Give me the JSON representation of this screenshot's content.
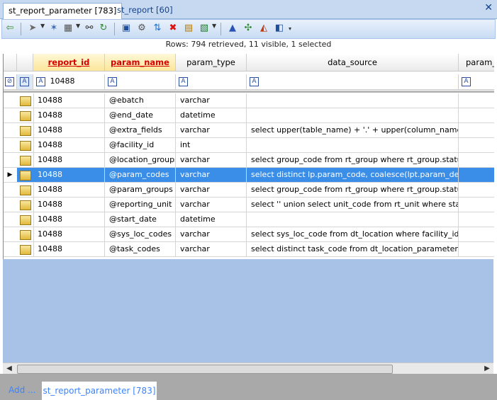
{
  "tabs": [
    {
      "label": "st_report_parameter [783]",
      "active": true
    },
    {
      "label": "st_report [60]",
      "active": false
    }
  ],
  "close_glyph": "✕",
  "toolbar": {
    "icons": [
      "back-arrow-icon",
      "run-icon",
      "pin-icon",
      "grid-icon",
      "binoculars-icon",
      "refresh-icon",
      "save-icon",
      "gear-icon",
      "sort-icon",
      "delete-icon",
      "export-icon",
      "excel-icon",
      "chart-icon",
      "tools-icon",
      "pdf-icon",
      "filter-icon",
      "more-icon"
    ]
  },
  "status": "Rows: 794 retrieved, 11 visible, 1 selected",
  "columns": [
    "report_id",
    "param_name",
    "param_type",
    "data_source",
    "param_"
  ],
  "filter": {
    "report_id": "10488"
  },
  "rows": [
    {
      "report_id": "10488",
      "param_name": "@ebatch",
      "param_type": "varchar",
      "data_source": ""
    },
    {
      "report_id": "10488",
      "param_name": "@end_date",
      "param_type": "datetime",
      "data_source": ""
    },
    {
      "report_id": "10488",
      "param_name": "@extra_fields",
      "param_type": "varchar",
      "data_source": "select upper(table_name) + '.' + upper(column_name)..."
    },
    {
      "report_id": "10488",
      "param_name": "@facility_id",
      "param_type": "int",
      "data_source": ""
    },
    {
      "report_id": "10488",
      "param_name": "@location_groups",
      "param_type": "varchar",
      "data_source": "select group_code from rt_group where rt_group.status..."
    },
    {
      "report_id": "10488",
      "param_name": "@param_codes",
      "param_type": "varchar",
      "data_source": "select distinct lp.param_code, coalesce(lpt.param_desc..."
    },
    {
      "report_id": "10488",
      "param_name": "@param_groups",
      "param_type": "varchar",
      "data_source": "select group_code from rt_group where rt_group.status..."
    },
    {
      "report_id": "10488",
      "param_name": "@reporting_unit",
      "param_type": "varchar",
      "data_source": "select '' union select unit_code from rt_unit where statu..."
    },
    {
      "report_id": "10488",
      "param_name": "@start_date",
      "param_type": "datetime",
      "data_source": ""
    },
    {
      "report_id": "10488",
      "param_name": "@sys_loc_codes",
      "param_type": "varchar",
      "data_source": "select sys_loc_code from dt_location where facility_id in..."
    },
    {
      "report_id": "10488",
      "param_name": "@task_codes",
      "param_type": "varchar",
      "data_source": "select distinct task_code from dt_location_parameter w..."
    }
  ],
  "selected_row": 5,
  "bottom": {
    "add_label": "Add ...",
    "tab_label": "st_report_parameter [783]"
  },
  "colors": {
    "selection": "#3b8ee8",
    "key_header": "#d60000",
    "empty_area": "#a7c2e6"
  }
}
